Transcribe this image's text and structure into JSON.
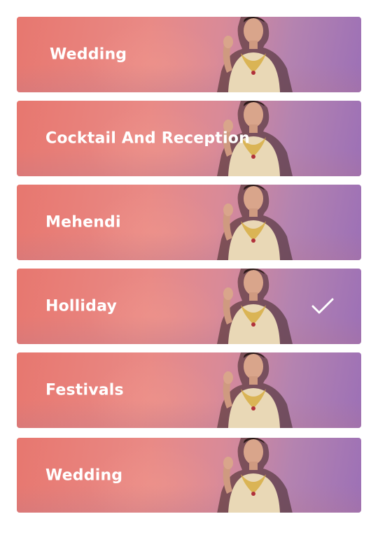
{
  "occasions": [
    {
      "label": "Wedding",
      "selected": false
    },
    {
      "label": "Cocktail And Reception",
      "selected": false
    },
    {
      "label": "Mehendi",
      "selected": false
    },
    {
      "label": "Holliday",
      "selected": true
    },
    {
      "label": "Festivals",
      "selected": false
    },
    {
      "label": "Wedding",
      "selected": false
    }
  ],
  "icons": {
    "selected": "checkmark-icon",
    "card_image": "model-photo"
  },
  "colors": {
    "card_left": "#e7776f",
    "card_right": "#9c70b6",
    "text": "#ffffff"
  }
}
